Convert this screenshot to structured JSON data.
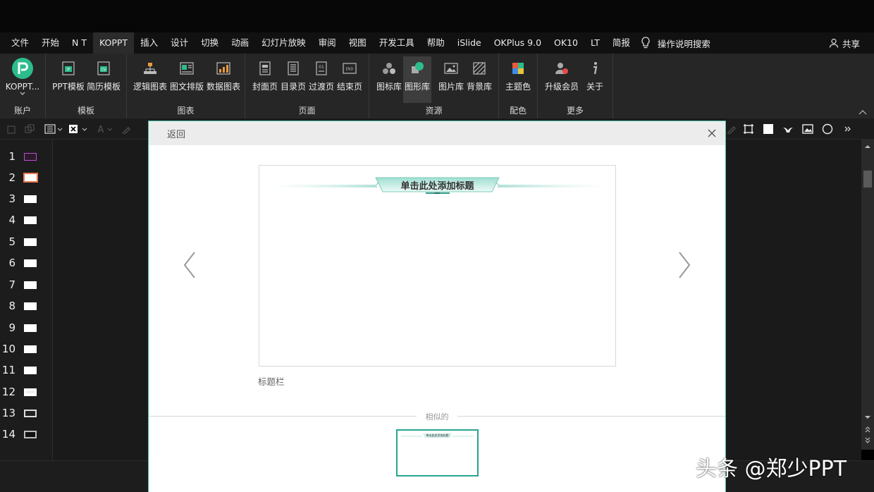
{
  "menu": {
    "items": [
      "文件",
      "开始",
      "N T",
      "KOPPT",
      "插入",
      "设计",
      "切换",
      "动画",
      "幻灯片放映",
      "审阅",
      "视图",
      "开发工具",
      "帮助",
      "iSlide",
      "OKPlus 9.0",
      "OK10",
      "LT",
      "简报"
    ],
    "active": "KOPPT",
    "tell_me": "操作说明搜索",
    "share": "共享"
  },
  "ribbon": {
    "groups": {
      "account": {
        "label": "账户",
        "button": "KOPPT..."
      },
      "template": {
        "label": "模板",
        "buttons": [
          "PPT模板",
          "简历模板"
        ]
      },
      "chart": {
        "label": "图表",
        "buttons": [
          "逻辑图表",
          "图文排版",
          "数据图表"
        ]
      },
      "page": {
        "label": "页面",
        "buttons": [
          "封面页",
          "目录页",
          "过渡页",
          "结束页"
        ]
      },
      "resource": {
        "label": "资源",
        "buttons": [
          "图标库",
          "图形库",
          "图片库",
          "背景库"
        ]
      },
      "color": {
        "label": "配色",
        "buttons": [
          "主题色"
        ]
      },
      "more": {
        "label": "更多",
        "buttons": [
          "升级会员",
          "关于"
        ]
      }
    },
    "selected_button": "图形库"
  },
  "slides": [
    "1",
    "2",
    "3",
    "4",
    "5",
    "6",
    "7",
    "8",
    "9",
    "10",
    "11",
    "12",
    "13",
    "14"
  ],
  "dialog": {
    "back": "返回",
    "preview_title": "单击此处添加标题",
    "caption": "标题栏",
    "similar_label": "相似的",
    "similar_thumb_title": "单击此处添加标题"
  },
  "watermark": "头条 @郑少PPT",
  "colors": {
    "accent": "#46b7a6",
    "selected_border": "#27a58f",
    "ribbon_bg": "#262626",
    "menu_bg": "#111111"
  }
}
